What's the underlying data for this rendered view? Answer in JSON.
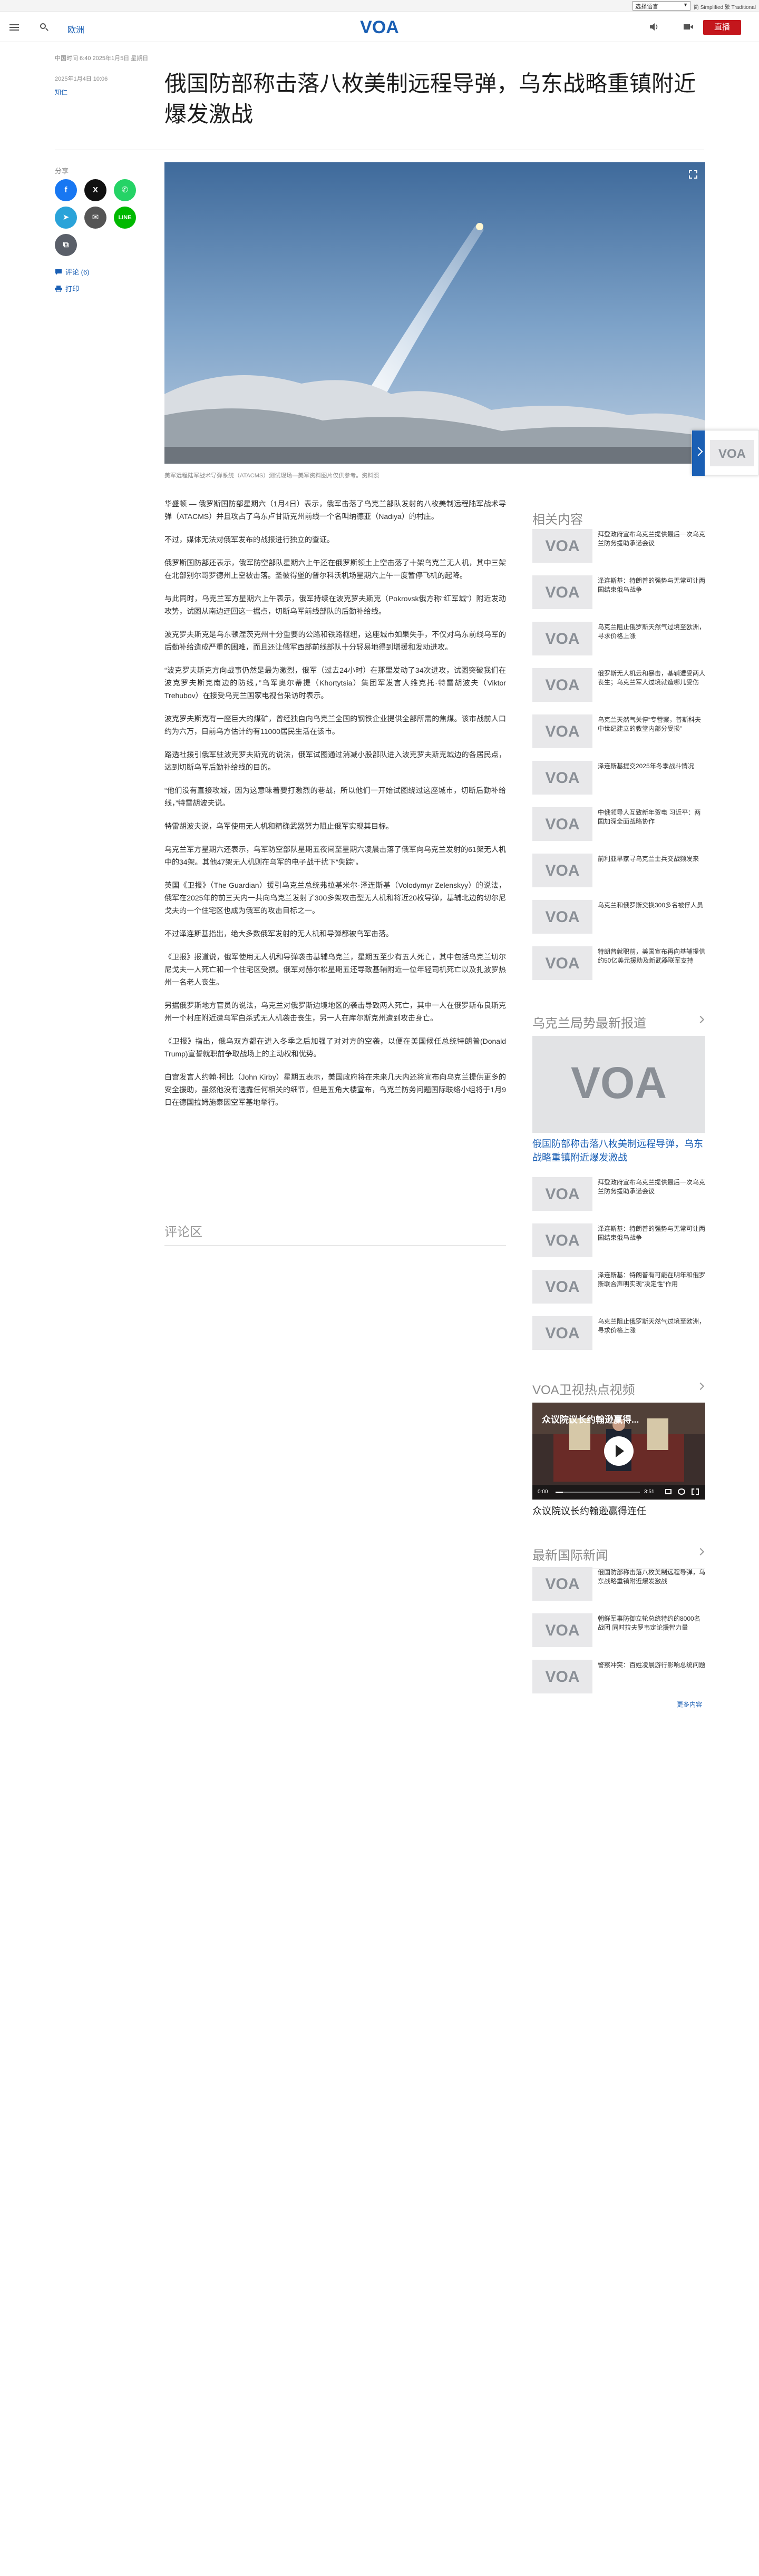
{
  "topbar": {
    "language_select": "选择语言",
    "scripts": "简 Simplified  繁 Traditional"
  },
  "header": {
    "section": "欧洲",
    "logo_text": "VOA",
    "live_label": "直播"
  },
  "article": {
    "top_meta": "中国时间 6:40 2025年1月5日 星期日",
    "date": "2025年1月4日 10:06",
    "author": "知仁",
    "title": "俄国防部称击落八枚美制远程导弹，乌东战略重镇附近爆发激战",
    "caption": "美军远程陆军战术导弹系统（ATACMS）测试现场—美军资料图片仅供参考。资料照",
    "paragraphs": [
      "华盛顿 — 俄罗斯国防部星期六（1月4日）表示，俄军击落了乌克兰部队发射的八枚美制远程陆军战术导弹（ATACMS）并且攻占了乌东卢甘斯克州前线一个名叫纳德亚（Nadiya）的村庄。",
      "不过，媒体无法对俄军发布的战报进行独立的查证。",
      "俄罗斯国防部还表示，俄军防空部队星期六上午还在俄罗斯领土上空击落了十架乌克兰无人机，其中三架在北部别尔哥罗德州上空被击落。圣彼得堡的普尔科沃机场星期六上午一度暂停飞机的起降。",
      "与此同时，乌克兰军方星期六上午表示，俄军持续在波克罗夫斯克（Pokrovsk俄方称“红军城”）附近发动攻势，试图从南边迂回这一据点，切断乌军前线部队的后勤补给线。",
      "波克罗夫斯克是乌东顿涅茨克州十分重要的公路和铁路枢纽，这座城市如果失手，不仅对乌东前线乌军的后勤补给造成严重的困难，而且还让俄军西部前线部队十分轻易地得到增援和发动进攻。",
      "“波克罗夫斯克方向战事仍然是最为激烈，俄军（过去24小时）在那里发动了34次进攻，试图突破我们在波克罗夫斯克南边的防线，”乌军奥尔蒂提（Khortytsia）集团军发言人维克托·特雷胡波夫（Viktor Trehubov）在接受乌克兰国家电视台采访时表示。",
      "波克罗夫斯克有一座巨大的煤矿，曾经独自向乌克兰全国的钢铁企业提供全部所需的焦煤。该市战前人口约为六万，目前乌方估计约有11000居民生活在该市。",
      "路透社援引俄军驻波克罗夫斯克的说法，俄军试图通过消减小股部队进入波克罗夫斯克城边的各居民点，达到切断乌军后勤补给线的目的。",
      "“他们没有直接攻城，因为这意味着要打激烈的巷战，所以他们一开始试图绕过这座城市，切断后勤补给线，”特雷胡波夫说。",
      "特雷胡波夫说，乌军使用无人机和精确武器努力阻止俄军实现其目标。",
      "乌克兰军方星期六还表示，乌军防空部队星期五夜间至星期六凌晨击落了俄军向乌克兰发射的61架无人机中的34架。其他47架无人机则在乌军的电子战干扰下“失踪”。",
      "英国《卫报》（The Guardian）援引乌克兰总统弗拉基米尔·泽连斯基（Volodymyr Zelenskyy）的说法，俄军在2025年的前三天内一共向乌克兰发射了300多架攻击型无人机和将近20枚导弹，基辅北边的切尔尼戈夫的一个住宅区也成为俄军的攻击目标之一。",
      "不过泽连斯基指出，绝大多数俄军发射的无人机和导弹都被乌军击落。",
      "《卫报》报道说，俄军使用无人机和导弹袭击基辅乌克兰，星期五至少有五人死亡，其中包括乌克兰切尔尼戈夫一人死亡和一个住宅区受损。俄军对赫尔松星期五还导致基辅附近一位年轻司机死亡以及扎波罗热州一名老人丧生。",
      "另据俄罗斯地方官员的说法，乌克兰对俄罗斯边境地区的袭击导致两人死亡，其中一人在俄罗斯布良斯克州一个村庄附近遭乌军自杀式无人机袭击丧生，另一人在库尔斯克州遭到攻击身亡。",
      "《卫报》指出，俄乌双方都在进入冬季之后加强了对对方的空袭，以便在美国候任总统特朗普(Donald Trump)宣誓就职前争取战场上的主动权和优势。",
      "白宫发言人约翰·柯比（John Kirby）星期五表示，美国政府将在未来几天内还将宣布向乌克兰提供更多的安全援助，虽然他没有透露任何相关的细节，但是五角大楼宣布，乌克兰防务问题国际联络小组将于1月9日在德国拉姆施泰因空军基地举行。"
    ],
    "comments_heading": "评论区"
  },
  "share": {
    "label": "分享",
    "comments_link": "评论 (6)",
    "print_link": "打印"
  },
  "sidebar": {
    "related_heading": "相关内容",
    "related": [
      "拜登政府宣布乌克兰提供最后一次乌克兰防务援助承诺会议",
      "泽连斯基：特朗普的强势与无常可让两国结束俄乌战争",
      "乌克兰阻止俄罗斯天然气过境至欧洲，寻求价格上涨",
      "俄罗斯无人机云和暴击，基辅遭受两人丧生；乌克兰军人过境就造哪儿受伤",
      "乌克兰天然气关停“专营案，普斯科夫中世纪建立的教堂内部分受损”",
      "泽连斯基提交2025年冬季战斗情况",
      "中俄领导人互致新年贺电 习近平：两国加深全面战略协作",
      "前利亚早家寻乌克兰士兵交战频发来",
      "乌克兰和俄罗斯交换300多名被俘人员",
      "特朗普就职前，美国宣布再向基辅提供约50亿美元援助及新武器联军支持"
    ],
    "latest_heading": "乌克兰局势最新报道",
    "latest_big_title": "俄国防部称击落八枚美制远程导弹，乌东战略重镇附近爆发激战",
    "latest": [
      "拜登政府宣布乌克兰提供最后一次乌克兰防务援助承诺会议",
      "泽连斯基：特朗普的强势与无常可让两国结束俄乌战争",
      "泽连斯基：特朗普有可能在明年和俄罗斯联合声明实现“决定性”作用",
      "乌克兰阻止俄罗斯天然气过境至欧洲，寻求价格上涨"
    ],
    "video_heading": "VOA卫视热点视频",
    "video_overlay": "众议院议长约翰逊赢得...",
    "video_time": "0:00",
    "video_duration": "3:51",
    "video_title": "众议院议长约翰逊赢得连任",
    "world_heading": "最新国际新闻",
    "world": [
      "俄国防部称击落八枚美制远程导弹，乌东战略重镇附近爆发激战",
      "朝鲜军事防御立轮总统特约的8000名战团 同时拉夫罗韦定论援智力量",
      "警察冲突：百姓凌晨游行影响总统问题"
    ],
    "more_link": "更多内容"
  },
  "colors": {
    "brand_blue": "#1a5fb4",
    "live_red": "#c4161c",
    "facebook": "#1877f2",
    "x": "#111111",
    "whatsapp": "#25d366",
    "telegram": "#2aa3d9",
    "email": "#555555",
    "line": "#00b900",
    "copy": "#5a5f69"
  },
  "icons": [
    "menu-icon",
    "search-icon",
    "audio-icon",
    "video-icon",
    "facebook-icon",
    "x-icon",
    "whatsapp-icon",
    "telegram-icon",
    "email-icon",
    "line-icon",
    "copy-link-icon",
    "comment-icon",
    "print-icon",
    "expand-icon",
    "play-icon",
    "chevron-right-icon"
  ]
}
